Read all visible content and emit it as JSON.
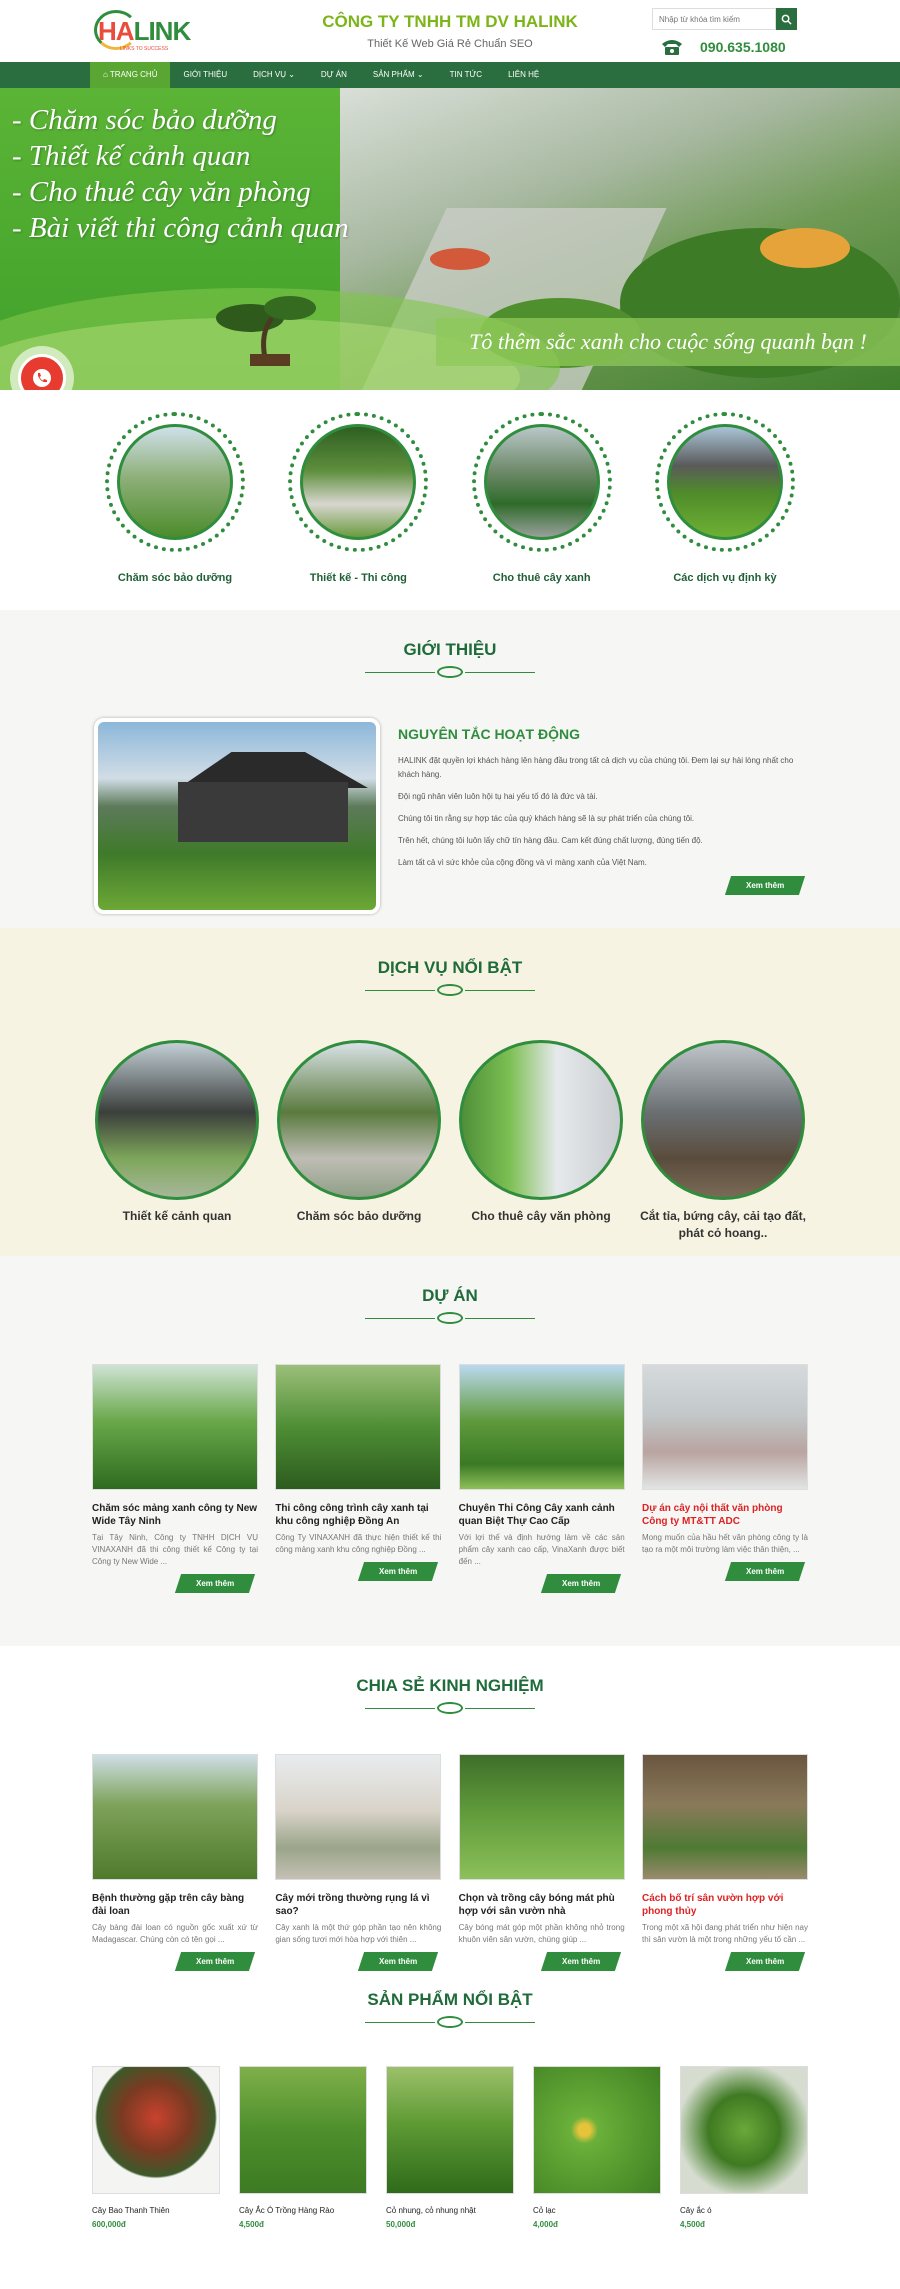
{
  "header": {
    "logo_text_a": "HA",
    "logo_text_b": "LINK",
    "logo_tagline": "LINKS TO SUCCESS",
    "company_name": "CÔNG TY TNHH TM DV HALINK",
    "company_slogan": "Thiết Kế Web Giá Rẻ Chuẩn SEO",
    "search_placeholder": "Nhập từ khóa tìm kiếm",
    "phone": "090.635.1080"
  },
  "nav": [
    "TRANG CHỦ",
    "GIỚI THIỆU",
    "DỊCH VỤ",
    "DỰ ÁN",
    "SẢN PHẨM",
    "TIN TỨC",
    "LIÊN HỆ"
  ],
  "hero": {
    "lines": [
      "- Chăm sóc bảo dưỡng",
      "- Thiết kế cảnh quan",
      "- Cho thuê cây văn phòng",
      "- Bài viết thi công cảnh quan"
    ],
    "slogan": "Tô thêm sắc xanh cho cuộc sống quanh bạn !"
  },
  "services": [
    "Chăm sóc bảo dưỡng",
    "Thiết kế - Thi công",
    "Cho thuê cây xanh",
    "Các dịch vụ định kỳ"
  ],
  "intro": {
    "title": "GIỚI THIỆU",
    "heading": "NGUYÊN TẮC HOẠT ĐỘNG",
    "paragraphs": [
      "HALINK đặt quyền lợi khách hàng lên hàng đầu trong tất cả dịch vụ của chúng tôi. Đem lại sự hài lòng nhất cho khách hàng.",
      "Đội ngũ nhân viên luôn hội tụ hai yếu tố đó là đức và tài.",
      "Chúng tôi tin rằng sự hợp tác của quý khách hàng sẽ là sự phát triển của chúng tôi.",
      "Trên hết, chúng tôi luôn lấy chữ tín hàng đầu. Cam kết đúng chất lượng, đúng tiến độ.",
      "Làm tất cả vì sức khỏe của cộng đồng và vì màng xanh của Việt Nam."
    ],
    "more": "Xem thêm"
  },
  "featured": {
    "title": "DỊCH VỤ NỔI BẬT",
    "items": [
      "Thiết kế cảnh quan",
      "Chăm sóc bảo dưỡng",
      "Cho thuê cây văn phòng",
      "Cắt tỉa, bứng cây, cải tạo đất, phát cỏ hoang.."
    ]
  },
  "projects": {
    "title": "DỰ ÁN",
    "more": "Xem thêm",
    "items": [
      {
        "title": "Chăm sóc mảng xanh công ty New Wide Tây Ninh",
        "desc": "Tại Tây Ninh, Công ty TNHH DỊCH VỤ VINAXANH đã thi công thiết kế Công ty tại Công ty New Wide ...",
        "red": false
      },
      {
        "title": "Thi công công trình cây xanh tại khu công nghiệp Đồng An",
        "desc": "Công Ty VINAXANH đã thực hiện thiết kế thi công mảng xanh khu công nghiệp Đồng ...",
        "red": false
      },
      {
        "title": "Chuyên Thi Công Cây xanh cảnh quan Biệt Thự Cao Cấp",
        "desc": "Với lợi thế và định hướng làm về các sản phẩm cây xanh cao cấp, VinaXanh được biết đến ...",
        "red": false
      },
      {
        "title": "Dự án cây nội thất văn phòng Công ty MT&TT ADC",
        "desc": "Mong muốn của hầu hết văn phòng công ty là tạo ra một môi trường làm việc thân thiện, ...",
        "red": true
      }
    ]
  },
  "experience": {
    "title": "CHIA SẺ KINH NGHIỆM",
    "more": "Xem thêm",
    "items": [
      {
        "title": "Bệnh thường gặp trên cây bàng đài loan",
        "desc": "Cây bàng đài loan có nguồn gốc xuất xứ từ Madagascar. Chúng còn có tên gọi ...",
        "red": false
      },
      {
        "title": "Cây mới trồng thường rụng lá vì sao?",
        "desc": "Cây xanh là một thứ góp phần tạo nên không gian sống tươi mới hòa hợp với thiên ...",
        "red": false
      },
      {
        "title": "Chọn và trồng cây bóng mát phù hợp với sân vườn nhà",
        "desc": "Cây bóng mát góp một phần không nhỏ trong khuôn viên sân vườn, chúng giúp ...",
        "red": false
      },
      {
        "title": "Cách bố trí sân vườn hợp với phong thủy",
        "desc": "Trong một xã hội đang phát triển như hiện nay thì sân vườn là một trong những yếu tố cần ...",
        "red": true
      }
    ]
  },
  "products": {
    "title": "SẢN PHẨM NỔI BẬT",
    "items": [
      {
        "name": "Cây Bao Thanh Thiên",
        "price": "600,000đ"
      },
      {
        "name": "Cây Ắc Ó Trồng Hàng Rào",
        "price": "4,500đ"
      },
      {
        "name": "Cỏ nhung, cỏ nhung nhật",
        "price": "50,000đ"
      },
      {
        "name": "Cỏ lạc",
        "price": "4,000đ"
      },
      {
        "name": "Cây ắc ó",
        "price": "4,500đ"
      }
    ]
  }
}
